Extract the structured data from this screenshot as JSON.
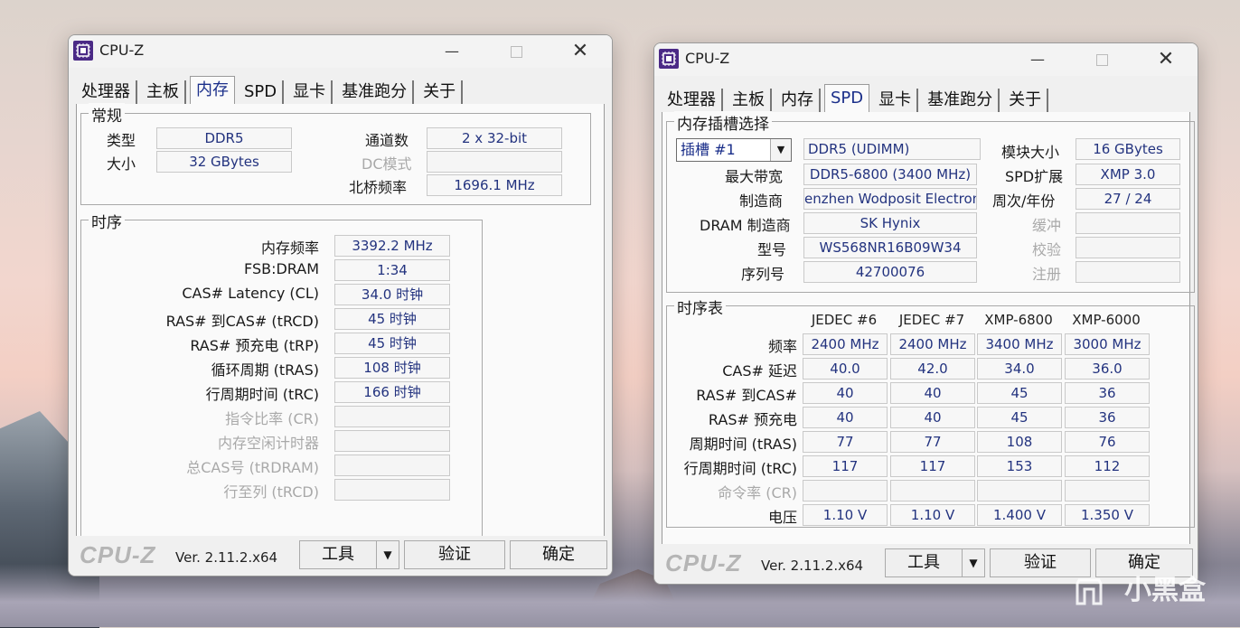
{
  "left_window": {
    "title": "CPU-Z",
    "tabs": [
      "处理器",
      "主板",
      "内存",
      "SPD",
      "显卡",
      "基准跑分",
      "关于"
    ],
    "active_tab": "内存",
    "general": {
      "group_label": "常规",
      "type_label": "类型",
      "type_value": "DDR5",
      "size_label": "大小",
      "size_value": "32 GBytes",
      "channels_label": "通道数",
      "channels_value": "2 x 32-bit",
      "dc_mode_label": "DC模式",
      "dc_mode_value": "",
      "nb_freq_label": "北桥频率",
      "nb_freq_value": "1696.1 MHz"
    },
    "timings": {
      "group_label": "时序",
      "rows": [
        {
          "label": "内存频率",
          "value": "3392.2 MHz",
          "disabled": false
        },
        {
          "label": "FSB:DRAM",
          "value": "1:34",
          "disabled": false
        },
        {
          "label": "CAS# Latency (CL)",
          "value": "34.0 时钟",
          "disabled": false
        },
        {
          "label": "RAS# 到CAS# (tRCD)",
          "value": "45 时钟",
          "disabled": false
        },
        {
          "label": "RAS# 预充电 (tRP)",
          "value": "45 时钟",
          "disabled": false
        },
        {
          "label": "循环周期 (tRAS)",
          "value": "108 时钟",
          "disabled": false
        },
        {
          "label": "行周期时间 (tRC)",
          "value": "166 时钟",
          "disabled": false
        },
        {
          "label": "指令比率 (CR)",
          "value": "",
          "disabled": true
        },
        {
          "label": "内存空闲计时器",
          "value": "",
          "disabled": true
        },
        {
          "label": "总CAS号 (tRDRAM)",
          "value": "",
          "disabled": true
        },
        {
          "label": "行至列 (tRCD)",
          "value": "",
          "disabled": true
        }
      ]
    },
    "footer": {
      "logo": "CPU-Z",
      "version": "Ver. 2.11.2.x64",
      "tools_label": "工具",
      "validate_label": "验证",
      "ok_label": "确定"
    }
  },
  "right_window": {
    "title": "CPU-Z",
    "tabs": [
      "处理器",
      "主板",
      "内存",
      "SPD",
      "显卡",
      "基准跑分",
      "关于"
    ],
    "active_tab": "SPD",
    "slot_group": {
      "group_label": "内存插槽选择",
      "slot_select": "插槽 #1",
      "module_type": "DDR5 (UDIMM)",
      "module_size_label": "模块大小",
      "module_size_value": "16 GBytes",
      "max_bw_label": "最大带宽",
      "max_bw_value": "DDR5-6800 (3400 MHz)",
      "spd_ext_label": "SPD扩展",
      "spd_ext_value": "XMP 3.0",
      "manufacturer_label": "制造商",
      "manufacturer_value": "enzhen Wodposit Electroni",
      "week_year_label": "周次/年份",
      "week_year_value": "27 / 24",
      "dram_mfr_label": "DRAM 制造商",
      "dram_mfr_value": "SK Hynix",
      "buffered_label": "缓冲",
      "buffered_value": "",
      "part_label": "型号",
      "part_value": "WS568NR16B09W34",
      "correction_label": "校验",
      "correction_value": "",
      "serial_label": "序列号",
      "serial_value": "42700076",
      "registered_label": "注册",
      "registered_value": ""
    },
    "timing_table": {
      "group_label": "时序表",
      "columns": [
        "JEDEC #6",
        "JEDEC #7",
        "XMP-6800",
        "XMP-6000"
      ],
      "rows": [
        {
          "label": "频率",
          "values": [
            "2400 MHz",
            "2400 MHz",
            "3400 MHz",
            "3000 MHz"
          ],
          "disabled": false
        },
        {
          "label": "CAS# 延迟",
          "values": [
            "40.0",
            "42.0",
            "34.0",
            "36.0"
          ],
          "disabled": false
        },
        {
          "label": "RAS# 到CAS#",
          "values": [
            "40",
            "40",
            "45",
            "36"
          ],
          "disabled": false
        },
        {
          "label": "RAS# 预充电",
          "values": [
            "40",
            "40",
            "45",
            "36"
          ],
          "disabled": false
        },
        {
          "label": "周期时间 (tRAS)",
          "values": [
            "77",
            "77",
            "108",
            "76"
          ],
          "disabled": false
        },
        {
          "label": "行周期时间 (tRC)",
          "values": [
            "117",
            "117",
            "153",
            "112"
          ],
          "disabled": false
        },
        {
          "label": "命令率 (CR)",
          "values": [
            "",
            "",
            "",
            ""
          ],
          "disabled": true
        },
        {
          "label": "电压",
          "values": [
            "1.10 V",
            "1.10 V",
            "1.400 V",
            "1.350 V"
          ],
          "disabled": false
        }
      ]
    },
    "footer": {
      "logo": "CPU-Z",
      "version": "Ver. 2.11.2.x64",
      "tools_label": "工具",
      "validate_label": "验证",
      "ok_label": "确定"
    }
  },
  "watermark": "小黑盒"
}
